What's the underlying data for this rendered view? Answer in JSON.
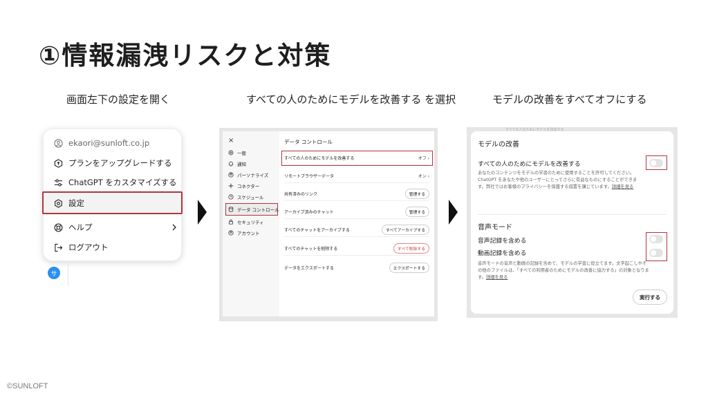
{
  "slide": {
    "title": "①情報漏洩リスクと対策",
    "copyright": "©SUNLOFT"
  },
  "steps": [
    {
      "caption": "画面左下の設定を開く"
    },
    {
      "caption": "すべての人のためにモデルを改善する を選択"
    },
    {
      "caption": "モデルの改善をすべてオフにする"
    }
  ],
  "menu": {
    "email": "ekaori@sunloft.co.jp",
    "items": [
      {
        "label": "プランをアップグレードする",
        "icon": "upgrade-icon"
      },
      {
        "label": "ChatGPT をカスタマイズする",
        "icon": "customize-icon"
      },
      {
        "label": "設定",
        "icon": "gear-icon"
      },
      {
        "label": "ヘルプ",
        "icon": "help-icon"
      },
      {
        "label": "ログアウト",
        "icon": "logout-icon"
      }
    ],
    "avatar_initial": "サ"
  },
  "data_controls": {
    "close": "×",
    "nav": [
      {
        "label": "一般",
        "icon": "gear-icon"
      },
      {
        "label": "通知",
        "icon": "bell-icon"
      },
      {
        "label": "パーソナライズ",
        "icon": "personalize-icon"
      },
      {
        "label": "コネクター",
        "icon": "connector-icon"
      },
      {
        "label": "スケジュール",
        "icon": "clock-icon"
      },
      {
        "label": "データ コントロール",
        "icon": "database-icon"
      },
      {
        "label": "セキュリティ",
        "icon": "lock-icon"
      },
      {
        "label": "アカウント",
        "icon": "account-icon"
      }
    ],
    "heading": "データ コントロール",
    "rows": [
      {
        "label": "すべての人のためにモデルを改善する",
        "value": "オフ ›"
      },
      {
        "label": "リモートブラウザーデータ",
        "value": "オン ›"
      },
      {
        "label": "共有済みのリンク",
        "button": "管理する"
      },
      {
        "label": "アーカイブ済みのチャット",
        "button": "管理する"
      },
      {
        "label": "すべてのチャットをアーカイブする",
        "button": "すべてアーカイブする"
      },
      {
        "label": "すべてのチャットを削除する",
        "button": "すべて削除する"
      },
      {
        "label": "データをエクスポートする",
        "button": "エクスポートする"
      }
    ]
  },
  "model_improvement": {
    "bg_text": "すべての人のためにモデルを改善する",
    "title": "モデルの改善",
    "improve_label": "すべての人のためにモデルを改善する",
    "improve_desc": "あなたのコンテンツをモデルの学習のために使用することを許可してください。ChatGPT をあなたや他のユーザーにとってさらに有益なものにすることができます。弊社ではお客様のプライバシーを保護する措置を講じています。",
    "improve_link": "詳細を見る",
    "voice_title": "音声モード",
    "voice_record": "音声記録を含める",
    "video_record": "動画記録を含める",
    "voice_desc": "音声モードの音声と動画の記録を含めて、モデルの学習に役立てます。文字起こしやその他のファイルは、「すべての利用者のためにモデルの改善に協力する」の対象となります。",
    "voice_link": "詳細を見る",
    "execute_button": "実行する",
    "toggles": {
      "improve": 0,
      "voice": 0,
      "video": 0
    }
  }
}
